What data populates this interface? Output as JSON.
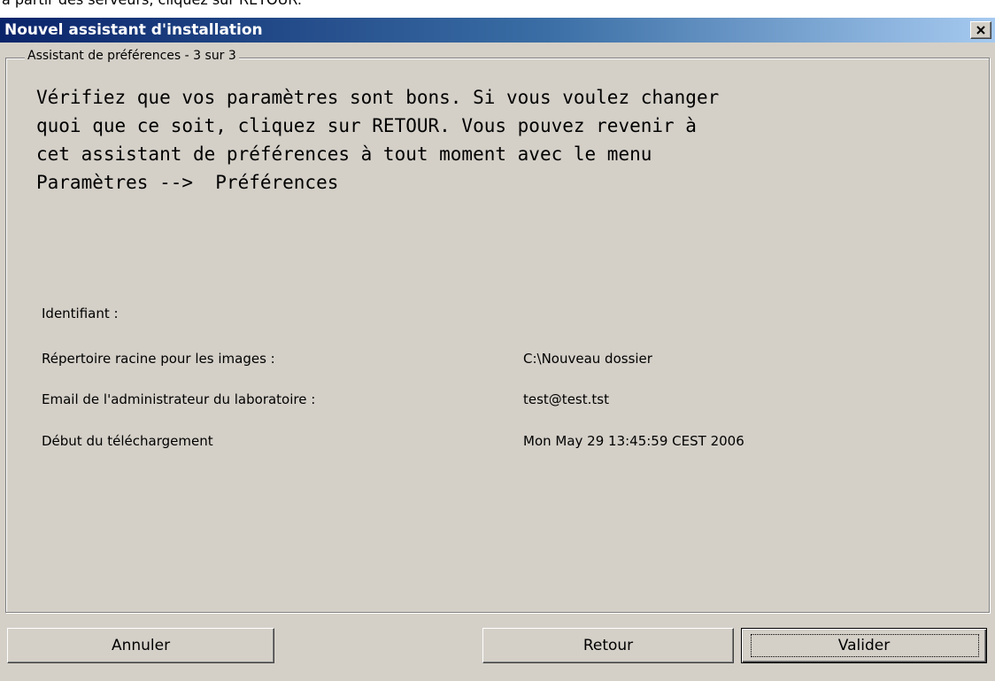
{
  "page": {
    "background_clipped_text": "à partir des serveurs, cliquez sur RETOUR."
  },
  "window": {
    "title": "Nouvel assistant d'installation",
    "close_icon": "close-x-icon",
    "colors": {
      "titlebar_start": "#0a246a",
      "titlebar_end": "#a6caf0",
      "face": "#d4d0c8"
    }
  },
  "wizard": {
    "group_title": "Assistant de préférences - 3 sur 3",
    "intro_lines": [
      "Vérifiez que vos paramètres sont bons. Si vous voulez changer",
      "quoi que ce soit, cliquez sur RETOUR. Vous pouvez revenir à",
      "cet assistant de préférences à tout moment avec le menu",
      "Paramètres -->  Préférences"
    ],
    "fields": [
      {
        "label": "Identifiant :",
        "value": ""
      },
      {
        "label": "Répertoire racine pour les images :",
        "value": "C:\\Nouveau dossier"
      },
      {
        "label": "Email de l'administrateur du laboratoire :",
        "value": "test@test.tst"
      },
      {
        "label": "Début du téléchargement",
        "value": "Mon May 29 13:45:59 CEST 2006"
      }
    ]
  },
  "buttons": {
    "cancel": "Annuler",
    "back": "Retour",
    "ok": "Valider"
  }
}
